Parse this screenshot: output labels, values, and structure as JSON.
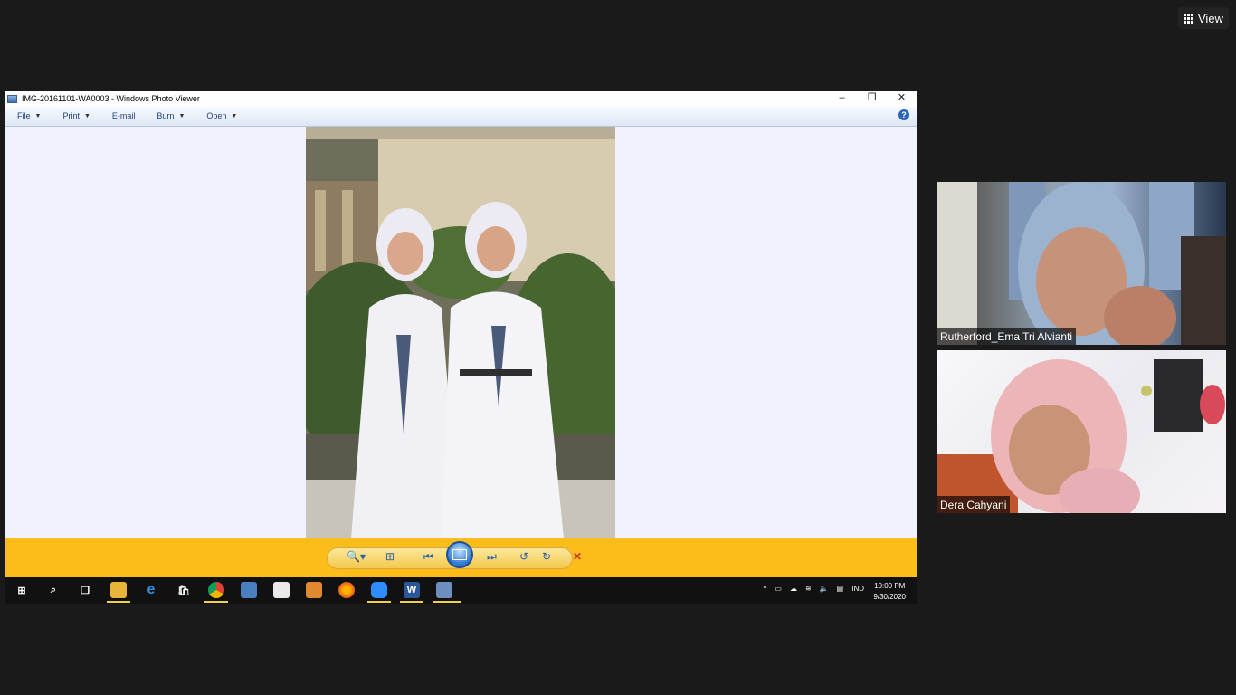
{
  "zoom": {
    "view_label": "View",
    "participants": [
      {
        "name": "Rutherford_Ema Tri Alvianti"
      },
      {
        "name": "Dera Cahyani"
      }
    ]
  },
  "photo_viewer": {
    "title": "IMG-20161101-WA0003 - Windows Photo Viewer",
    "window_controls": {
      "minimize": "–",
      "maximize": "❐",
      "close": "✕"
    },
    "menu": [
      {
        "label": "File",
        "caret": "▼"
      },
      {
        "label": "Print",
        "caret": "▼"
      },
      {
        "label": "E-mail",
        "caret": ""
      },
      {
        "label": "Burn",
        "caret": "▼"
      },
      {
        "label": "Open",
        "caret": "▼"
      }
    ],
    "help": "?"
  },
  "taskbar": {
    "language": "IND",
    "time": "10:00 PM",
    "date": "9/30/2020",
    "word_icon_letter": "W"
  },
  "colors": {
    "control_bar": "#fcbd1b",
    "viewer_bg": "#f0f3fb",
    "page_bg": "#1a1a1a"
  }
}
